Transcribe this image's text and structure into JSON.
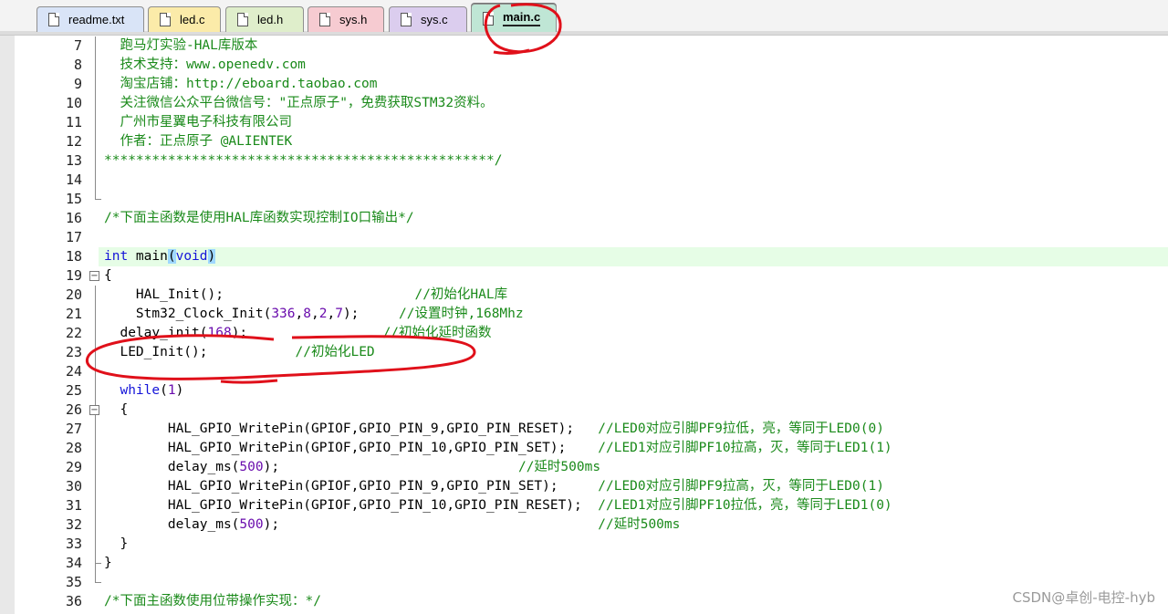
{
  "tabs": [
    {
      "label": "readme.txt",
      "bg": "#d9e4f7"
    },
    {
      "label": "led.c",
      "bg": "#fbeba9"
    },
    {
      "label": "led.h",
      "bg": "#dfeecb"
    },
    {
      "label": "sys.h",
      "bg": "#f6cbd1"
    },
    {
      "label": "sys.c",
      "bg": "#dbcdee"
    },
    {
      "label": "main.c",
      "bg": "#bfe6d5",
      "active": true
    }
  ],
  "lines": [
    {
      "n": "7",
      "code": "  跑马灯实验-HAL库版本",
      "kind": "comment"
    },
    {
      "n": "8",
      "code": "  技术支持：www.openedv.com",
      "kind": "comment"
    },
    {
      "n": "9",
      "code": "  淘宝店铺：http://eboard.taobao.com",
      "kind": "comment"
    },
    {
      "n": "10",
      "code": "  关注微信公众平台微信号：\"正点原子\"，免费获取STM32资料。",
      "kind": "comment"
    },
    {
      "n": "11",
      "code": "  广州市星翼电子科技有限公司",
      "kind": "comment"
    },
    {
      "n": "12",
      "code": "  作者：正点原子 @ALIENTEK",
      "kind": "comment"
    },
    {
      "n": "13",
      "code": "*************************************************/",
      "kind": "comment"
    },
    {
      "n": "14",
      "code": "",
      "kind": "plain"
    },
    {
      "n": "15",
      "code": "",
      "kind": "plain"
    },
    {
      "n": "16",
      "code": "/*下面主函数是使用HAL库函数实现控制IO口输出*/",
      "kind": "comment"
    },
    {
      "n": "17",
      "code": "",
      "kind": "plain"
    },
    {
      "n": "18",
      "code": "int main(void)",
      "kind": "main"
    },
    {
      "n": "19",
      "code": "{",
      "kind": "plain"
    },
    {
      "n": "20",
      "code": "    HAL_Init();                        //初始化HAL库",
      "kind": "mixed"
    },
    {
      "n": "21",
      "code": "    Stm32_Clock_Init(336,8,2,7);     //设置时钟,168Mhz",
      "kind": "mixed"
    },
    {
      "n": "22",
      "code": "  delay_init(168);                 //初始化延时函数",
      "kind": "mixed"
    },
    {
      "n": "23",
      "code": "  LED_Init();           //初始化LED",
      "kind": "mixed"
    },
    {
      "n": "24",
      "code": "",
      "kind": "plain"
    },
    {
      "n": "25",
      "code": "  while(1)",
      "kind": "while"
    },
    {
      "n": "26",
      "code": "  {",
      "kind": "plain"
    },
    {
      "n": "27",
      "code": "        HAL_GPIO_WritePin(GPIOF,GPIO_PIN_9,GPIO_PIN_RESET);   //LED0对应引脚PF9拉低，亮，等同于LED0(0)",
      "kind": "mixed"
    },
    {
      "n": "28",
      "code": "        HAL_GPIO_WritePin(GPIOF,GPIO_PIN_10,GPIO_PIN_SET);    //LED1对应引脚PF10拉高，灭，等同于LED1(1)",
      "kind": "mixed"
    },
    {
      "n": "29",
      "code": "        delay_ms(500);                              //延时500ms",
      "kind": "mixed"
    },
    {
      "n": "30",
      "code": "        HAL_GPIO_WritePin(GPIOF,GPIO_PIN_9,GPIO_PIN_SET);     //LED0对应引脚PF9拉高，灭，等同于LED0(1)",
      "kind": "mixed"
    },
    {
      "n": "31",
      "code": "        HAL_GPIO_WritePin(GPIOF,GPIO_PIN_10,GPIO_PIN_RESET);  //LED1对应引脚PF10拉低，亮，等同于LED1(0)",
      "kind": "mixed"
    },
    {
      "n": "32",
      "code": "        delay_ms(500);                                        //延时500ms",
      "kind": "mixed"
    },
    {
      "n": "33",
      "code": "  }",
      "kind": "plain"
    },
    {
      "n": "34",
      "code": "}",
      "kind": "plain"
    },
    {
      "n": "35",
      "code": "",
      "kind": "plain"
    },
    {
      "n": "36",
      "code": "/*下面主函数使用位带操作实现：*/",
      "kind": "comment"
    }
  ],
  "watermark": "CSDN@卓创-电控-hyb",
  "colors": {
    "comment": "#1a8a1a",
    "keyword": "#1414d9",
    "number": "#6a0dad",
    "highlight_line": "#e6fde6",
    "annotation": "#e0101a"
  }
}
